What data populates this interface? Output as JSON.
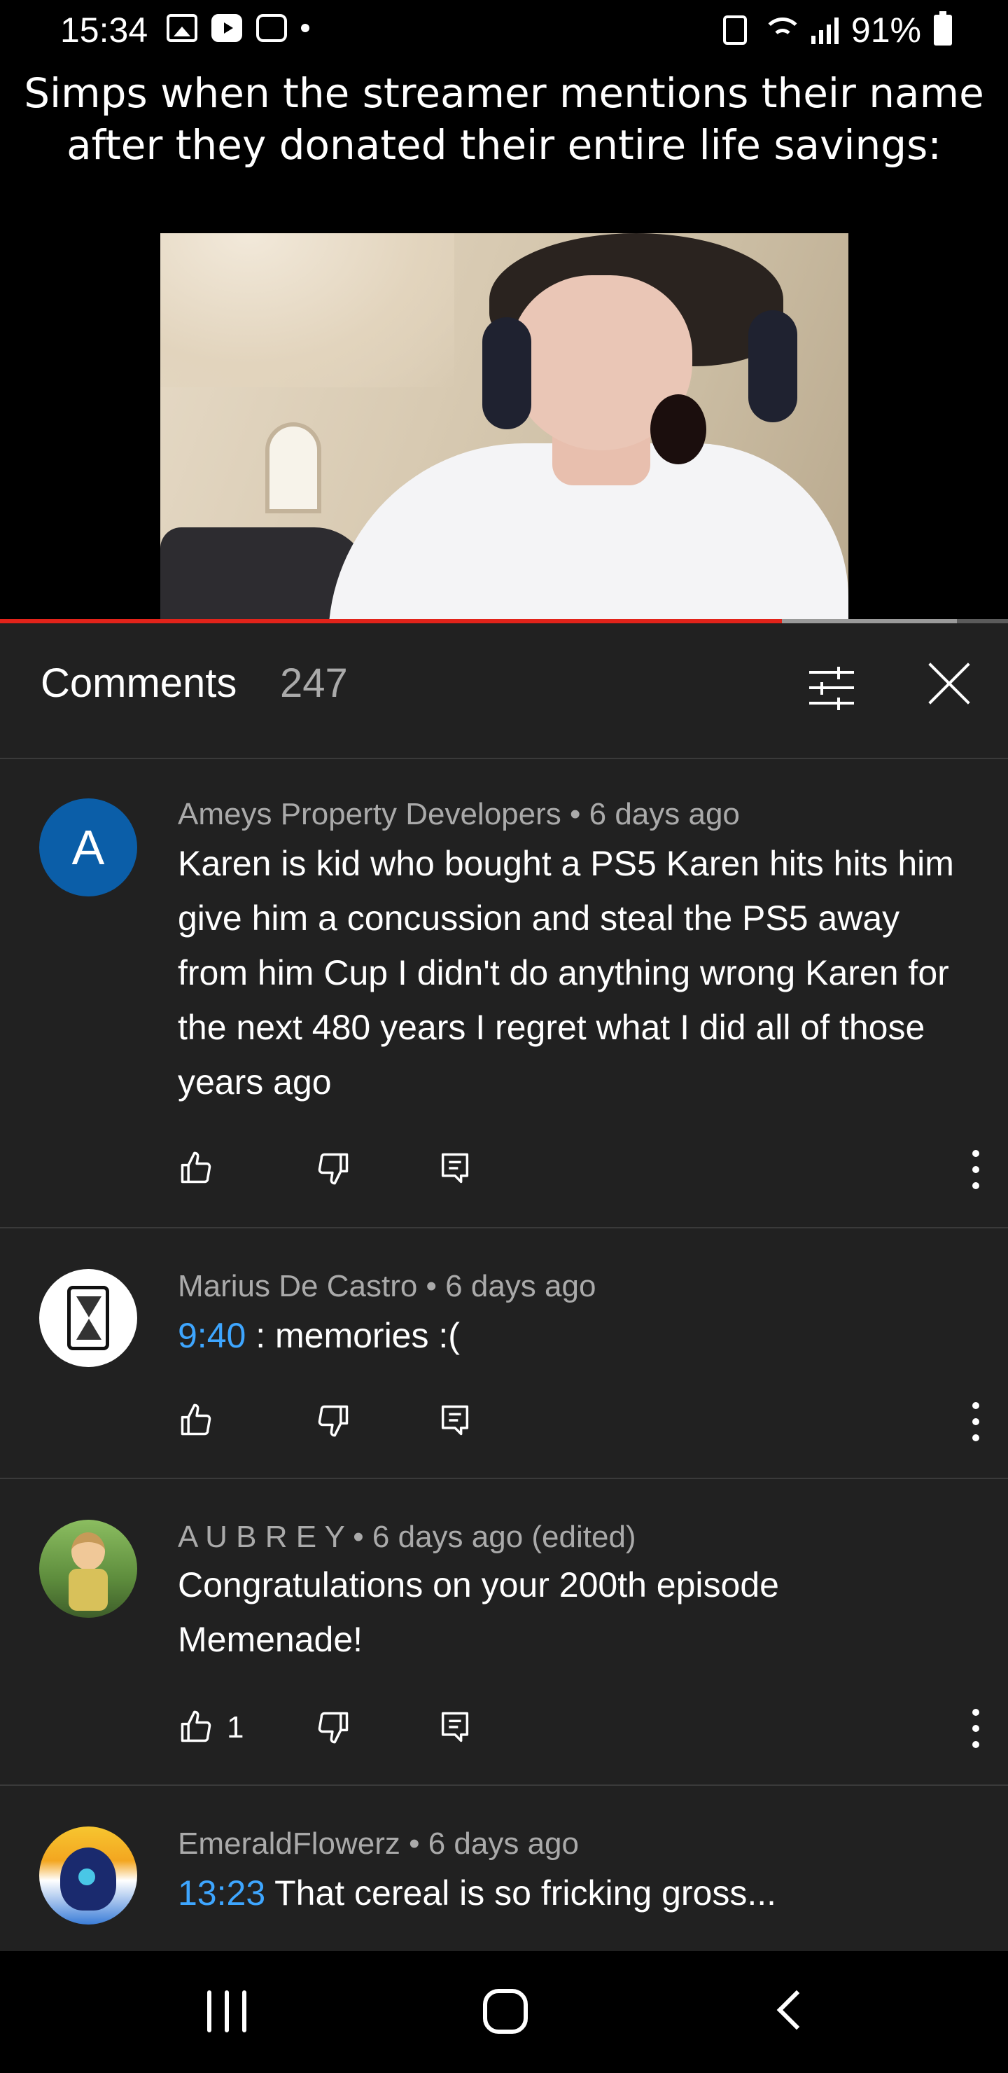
{
  "status_bar": {
    "time": "15:34",
    "battery": "91%",
    "icons_left": [
      "gallery-icon",
      "youtube-icon",
      "game-icon",
      "notification-dot"
    ],
    "icons_right": [
      "recycle-icon",
      "wifi-icon",
      "signal-icon",
      "battery-icon"
    ]
  },
  "video": {
    "caption": "Simps when the streamer mentions their name after they donated their entire life savings:",
    "progress": 0.776,
    "buffered": 0.949,
    "progress_color": "#e2231a"
  },
  "comments_panel": {
    "title": "Comments",
    "count": "247",
    "icons": [
      "sort-filter-icon",
      "close-icon"
    ],
    "items": [
      {
        "author": "Ameys Property Developers",
        "age": "6 days ago",
        "meta": "Ameys Property Developers • 6 days ago",
        "avatar_letter": "A",
        "avatar_color": "#0b5ea8",
        "text": "Karen is kid who bought a PS5 Karen hits hits him give him a concussion and steal the PS5 away from him Cup I didn't do anything wrong Karen for the next 480 years I regret what I did all of those years ago",
        "likes": ""
      },
      {
        "author": "Marius De Castro",
        "age": "6 days ago",
        "meta": "Marius De Castro • 6 days ago",
        "timestamp": "9:40",
        "text": " : memories :(",
        "likes": ""
      },
      {
        "author": "A U B R E Y",
        "age": "6 days ago (edited)",
        "meta": "A U B R E Y • 6 days ago (edited)",
        "text": "Congratulations on your 200th episode Memenade!",
        "likes": "1"
      },
      {
        "author": "EmeraldFlowerz",
        "age": "6 days ago",
        "meta": "EmeraldFlowerz • 6 days ago",
        "timestamp": "13:23",
        "text": " That cereal is so fricking gross...",
        "likes": ""
      }
    ],
    "link_color": "#3ea6ff"
  },
  "navbar": {
    "icons": [
      "recent-apps-icon",
      "home-icon",
      "back-icon"
    ]
  }
}
